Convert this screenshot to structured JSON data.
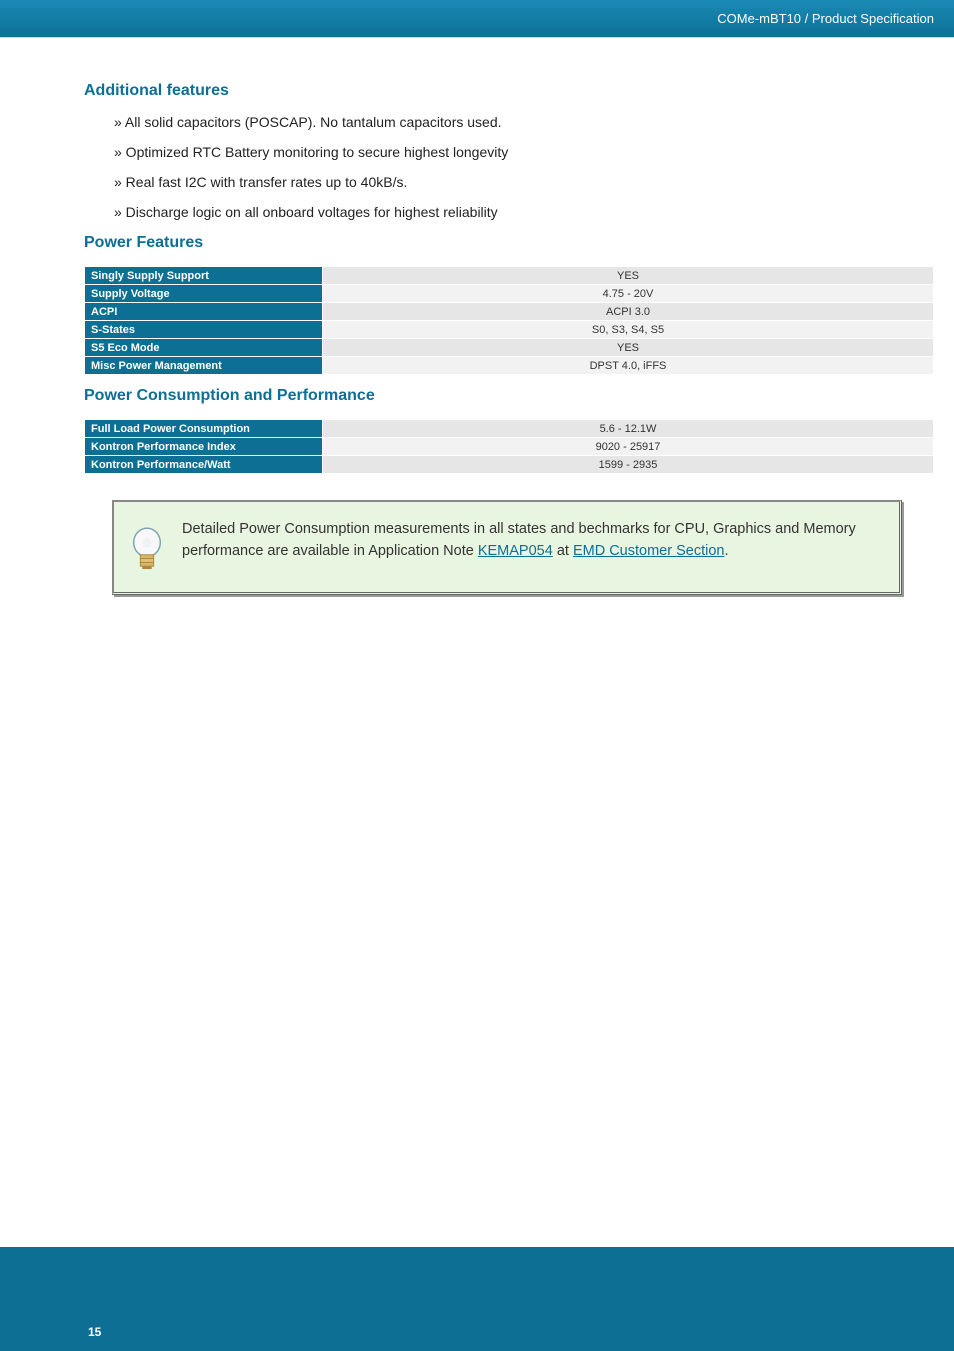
{
  "header": {
    "title": "COMe-mBT10 / Product Specification"
  },
  "page_number": "15",
  "section_af": {
    "heading": "Additional features",
    "items": [
      "» All solid capacitors (POSCAP). No tantalum capacitors used.",
      "» Optimized RTC Battery monitoring to secure highest longevity",
      "» Real fast I2C with transfer rates up to 40kB/s.",
      "» Discharge logic on all onboard voltages for highest reliability"
    ]
  },
  "section_pf": {
    "heading": "Power Features",
    "rows": [
      {
        "label": "Singly Supply Support",
        "value": "YES"
      },
      {
        "label": "Supply Voltage",
        "value": "4.75 - 20V"
      },
      {
        "label": "ACPI",
        "value": "ACPI 3.0"
      },
      {
        "label": "S-States",
        "value": "S0, S3, S4, S5"
      },
      {
        "label": "S5 Eco Mode",
        "value": "YES"
      },
      {
        "label": "Misc Power Management",
        "value": "DPST 4.0, iFFS"
      }
    ]
  },
  "section_pc": {
    "heading": "Power Consumption and Performance",
    "rows": [
      {
        "label": "Full Load Power Consumption",
        "value": "5.6 - 12.1W"
      },
      {
        "label": "Kontron Performance Index",
        "value": "9020 - 25917"
      },
      {
        "label": "Kontron Performance/Watt",
        "value": "1599 - 2935"
      }
    ]
  },
  "note": {
    "text_before": "Detailed Power Consumption measurements in all states and bechmarks for CPU, Graphics and Memory performance are available in Application Note ",
    "link1": "KEMAP054",
    "text_mid": " at ",
    "link2": "EMD Customer Section",
    "text_after": "."
  }
}
